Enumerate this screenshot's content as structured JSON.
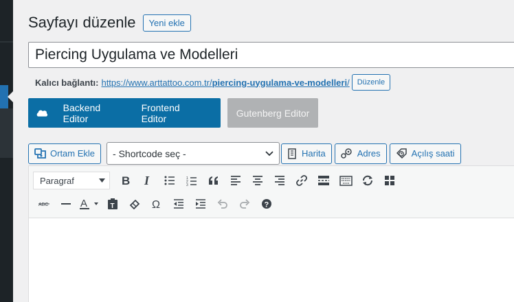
{
  "page": {
    "title": "Sayfayı düzenle",
    "add_new_label": "Yeni ekle"
  },
  "post": {
    "title": "Piercing Uygulama ve Modelleri"
  },
  "permalink": {
    "label": "Kalıcı bağlantı:",
    "base": "https://www.arttattoo.com.tr/",
    "slug": "piercing-uygulama-ve-modelleri",
    "trail": "/",
    "edit_label": "Düzenle"
  },
  "builder": {
    "backend_label": "Backend Editor",
    "frontend_label": "Frontend Editor",
    "gutenberg_label": "Gutenberg Editor",
    "brand_color": "#0b6ea5"
  },
  "media_bar": {
    "add_media_label": "Ortam Ekle",
    "shortcode_placeholder": "- Shortcode seç -",
    "map_label": "Harita",
    "address_label": "Adres",
    "hours_label": "Açılış saati"
  },
  "toolbar": {
    "format_value": "Paragraf",
    "row1": [
      "bold-icon",
      "italic-icon",
      "bullet-list-icon",
      "numbered-list-icon",
      "blockquote-icon",
      "align-left-icon",
      "align-center-icon",
      "align-right-icon",
      "link-icon",
      "read-more-icon",
      "toolbar-toggle-icon",
      "refresh-icon",
      "grid-icon"
    ],
    "row2": [
      "strikethrough-icon",
      "horizontal-line-icon",
      "text-color-icon",
      "paste-text-icon",
      "clear-formatting-icon",
      "special-character-icon",
      "outdent-icon",
      "indent-icon",
      "undo-icon",
      "redo-icon",
      "help-icon"
    ]
  },
  "colors": {
    "accent": "#2271b1",
    "admin_bar": "#1d2327",
    "background": "#f0f0f1"
  }
}
